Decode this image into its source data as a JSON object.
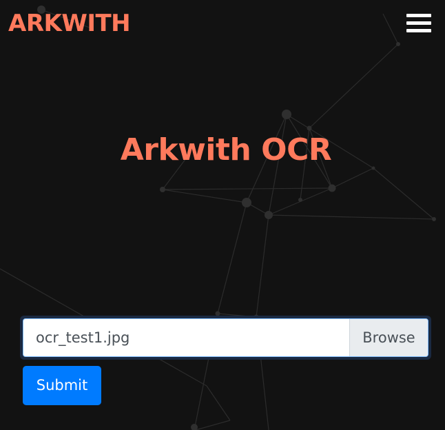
{
  "navbar": {
    "brand": "ARKWITH",
    "menu_icon": "hamburger-menu-icon"
  },
  "hero": {
    "title": "Arkwith OCR"
  },
  "upload_form": {
    "file_name": "ocr_test1.jpg",
    "browse_label": "Browse",
    "submit_label": "Submit"
  },
  "colors": {
    "background": "#121212",
    "accent": "#ff7a5c",
    "primary_button": "#007bff",
    "menu_icon": "#ffffff"
  }
}
